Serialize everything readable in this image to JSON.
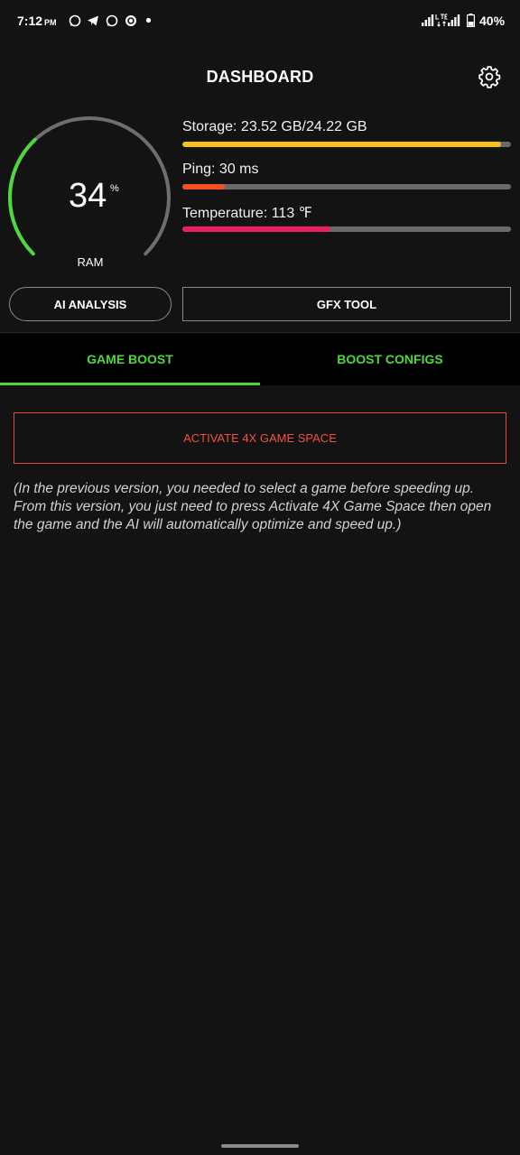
{
  "status_bar": {
    "time": "7:12",
    "ampm": "PM",
    "battery": "40%",
    "icons": [
      "whatsapp-icon",
      "telegram-icon",
      "whatsapp-icon",
      "app-icon",
      "dot-icon",
      "signal-icon",
      "lte-icon",
      "battery-icon"
    ]
  },
  "header": {
    "title": "DASHBOARD",
    "settings_icon": "gear-icon"
  },
  "ram": {
    "value": "34",
    "unit": "%",
    "label": "RAM",
    "percent": 34
  },
  "stats": [
    {
      "label": "Storage: 23.52 GB/24.22 GB",
      "fill_percent": 97,
      "color": "#f5c21b"
    },
    {
      "label": "Ping: 30 ms",
      "fill_percent": 13,
      "color": "#f4511e"
    },
    {
      "label": "Temperature: 113 ℉",
      "fill_percent": 45,
      "color": "#e91e63"
    }
  ],
  "buttons": {
    "ai_analysis": "AI ANALYSIS",
    "gfx_tool": "GFX TOOL"
  },
  "tabs": [
    {
      "label": "GAME BOOST",
      "active": true
    },
    {
      "label": "BOOST CONFIGS",
      "active": false
    }
  ],
  "activate_button": "ACTIVATE 4X GAME SPACE",
  "note": "(In the previous version, you needed to select a game before speeding up. From this version, you just need to press Activate 4X Game Space then open the game and the AI will automatically optimize and speed up.)",
  "colors": {
    "accent_green": "#4fd640",
    "danger_red": "#e8463a",
    "background": "#131313"
  }
}
